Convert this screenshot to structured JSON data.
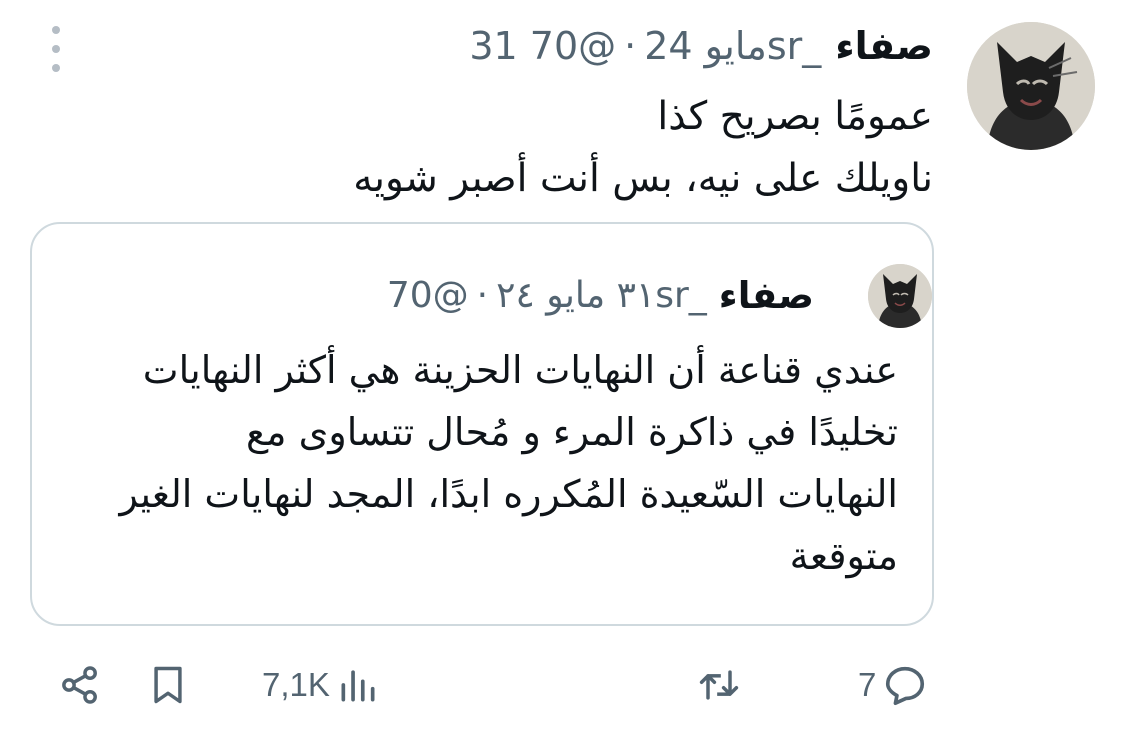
{
  "tweet": {
    "display_name": "صفاء",
    "handle": "@70sr_",
    "separator": "·",
    "date": "31 مايو 24",
    "text_lines": [
      "عمومًا بصريح كذا",
      "ناويلك على نيه، بس أنت أصبر شويه"
    ]
  },
  "quote": {
    "display_name": "صفاء",
    "handle": "@70sr_",
    "separator": "·",
    "date": "٣١ مايو ٢٤",
    "text_lines": [
      "عندي قناعة أن النهايات الحزينة هي أكثر النهايات",
      "تخليدًا في ذاكرة المرء و مُحال تتساوى مع",
      "النهايات السّعيدة المُكرره ابدًا، المجد لنهايات الغير",
      "متوقعة"
    ]
  },
  "actions": {
    "reply_count": "7",
    "views_count": "7,1K"
  },
  "icons": {
    "more": "more-vertical-icon",
    "reply": "reply-icon",
    "retweet": "retweet-icon",
    "views": "views-icon",
    "bookmark": "bookmark-icon",
    "share": "share-icon"
  },
  "colors": {
    "text_primary": "#0f1419",
    "text_secondary": "#536471",
    "border": "#cfd9de",
    "menu_dots": "#b5bdc5"
  }
}
